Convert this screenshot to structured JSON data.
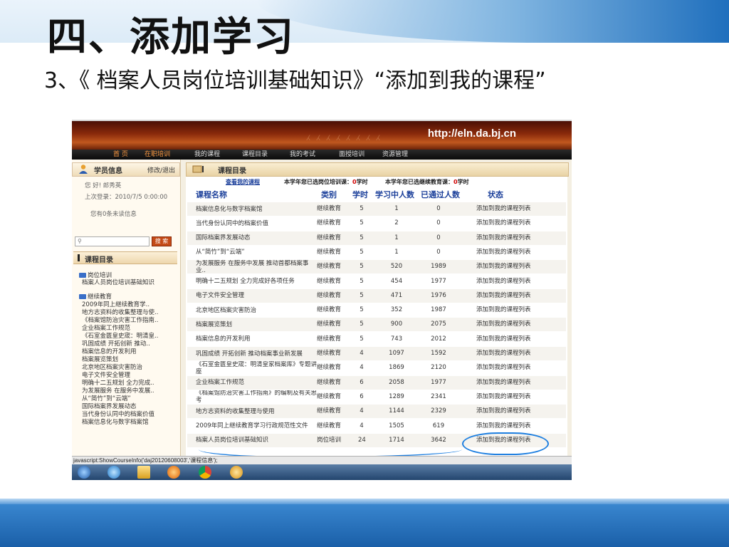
{
  "slide": {
    "title": "四、添加学习",
    "subtitle": "3、《 档案人员岗位培训基础知识》“添加到我的课程”"
  },
  "site": {
    "url": "http://eln.da.bj.cn",
    "nav": [
      "首 页",
      "在职培训",
      "我的课程",
      "课程目录",
      "我的考试",
      "面授培训",
      "资源管理"
    ]
  },
  "sidebar": {
    "student_info_title": "学员信息",
    "edit_logout": "修改/退出",
    "greeting": "您 好! 郎秀英",
    "last_login": "上次登录：2010/7/5 0:00:00",
    "unread": "您有0条未读信息",
    "search_button": "搜 索",
    "catalog_title": "课程目录",
    "tree": {
      "group1": "岗位培训",
      "group1_items": [
        "档案人员岗位培训基础知识"
      ],
      "group2": "继续教育",
      "group2_items": [
        "2009年同上继续教育学..",
        "地方志资料的收集整理与使..",
        "《档案馆防治灾害工作指南..",
        "企业档案工作规范",
        "《石室金匮皇史宬：明清皇..",
        "巩固成绩 开拓创新 推动..",
        "档案信息的开发利用",
        "档案展览策划",
        "北京地区档案灾害防治",
        "电子文件安全管理",
        "明确十二五规划 全力完成..",
        "为发展服务 在服务中发展..",
        "从“简竹”到“云端”",
        "国际档案界发展动态",
        "当代身份认同中的档案价值",
        "档案信息化与数字档案馆"
      ]
    }
  },
  "main": {
    "header_title": "课程目录",
    "my_courses_link": "查看我的课程",
    "summary1_prefix": "本学年您已选岗位培训课：",
    "summary1_value": "0",
    "summary1_unit": "学时",
    "summary2_prefix": "本学年您已选继续教育课：",
    "summary2_value": "0",
    "summary2_unit": "学时",
    "columns": {
      "name": "课程名称",
      "category": "类别",
      "hours": "学时",
      "learning": "学习中人数",
      "passed": "已通过人数",
      "status": "状态"
    },
    "rows": [
      {
        "name": "档案信息化与数字档案馆",
        "category": "继续教育",
        "hours": "5",
        "learning": "1",
        "passed": "0",
        "status": "添加到我的课程列表"
      },
      {
        "name": "当代身份认同中的档案价值",
        "category": "继续教育",
        "hours": "5",
        "learning": "2",
        "passed": "0",
        "status": "添加到我的课程列表"
      },
      {
        "name": "国际档案界发展动态",
        "category": "继续教育",
        "hours": "5",
        "learning": "1",
        "passed": "0",
        "status": "添加到我的课程列表"
      },
      {
        "name": "从“简竹”到“云端”",
        "category": "继续教育",
        "hours": "5",
        "learning": "1",
        "passed": "0",
        "status": "添加到我的课程列表"
      },
      {
        "name": "为发展服务 在服务中发展 推动首都档案事业..",
        "category": "继续教育",
        "hours": "5",
        "learning": "520",
        "passed": "1989",
        "status": "添加到我的课程列表"
      },
      {
        "name": "明确十二五规划 全力完成好各项任务",
        "category": "继续教育",
        "hours": "5",
        "learning": "454",
        "passed": "1977",
        "status": "添加到我的课程列表"
      },
      {
        "name": "电子文件安全管理",
        "category": "继续教育",
        "hours": "5",
        "learning": "471",
        "passed": "1976",
        "status": "添加到我的课程列表"
      },
      {
        "name": "北京地区档案灾害防治",
        "category": "继续教育",
        "hours": "5",
        "learning": "352",
        "passed": "1987",
        "status": "添加到我的课程列表"
      },
      {
        "name": "档案展览策划",
        "category": "继续教育",
        "hours": "5",
        "learning": "900",
        "passed": "2075",
        "status": "添加到我的课程列表"
      },
      {
        "name": "档案信息的开发利用",
        "category": "继续教育",
        "hours": "5",
        "learning": "743",
        "passed": "2012",
        "status": "添加到我的课程列表"
      },
      {
        "name": "巩固成绩 开拓创新 推动档案事业新发展",
        "category": "继续教育",
        "hours": "4",
        "learning": "1097",
        "passed": "1592",
        "status": "添加到我的课程列表"
      },
      {
        "name": "《石室金匮皇史宬：明清皇家档案库》专题讲座",
        "category": "继续教育",
        "hours": "4",
        "learning": "1869",
        "passed": "2120",
        "status": "添加到我的课程列表"
      },
      {
        "name": "企业档案工作规范",
        "category": "继续教育",
        "hours": "6",
        "learning": "2058",
        "passed": "1977",
        "status": "添加到我的课程列表"
      },
      {
        "name": "《档案馆防治灾害工作指南》的编制及有关思考",
        "category": "继续教育",
        "hours": "6",
        "learning": "1289",
        "passed": "2341",
        "status": "添加到我的课程列表"
      },
      {
        "name": "地方志资料的收集整理与使用",
        "category": "继续教育",
        "hours": "4",
        "learning": "1144",
        "passed": "2329",
        "status": "添加到我的课程列表"
      },
      {
        "name": "2009年同上继续教育学习行政规范性文件",
        "category": "继续教育",
        "hours": "4",
        "learning": "1505",
        "passed": "619",
        "status": "添加到我的课程列表"
      },
      {
        "name": "档案人员岗位培训基础知识",
        "category": "岗位培训",
        "hours": "24",
        "learning": "1714",
        "passed": "3642",
        "status": "添加到我的课程列表"
      }
    ]
  },
  "statusbar": "javascript:ShowCourseInfo('daj20120608003','课程信息');",
  "colors": {
    "accent_red": "#d00000",
    "link_blue": "#1b3f9a",
    "annotation_blue": "#1e7fe0"
  }
}
